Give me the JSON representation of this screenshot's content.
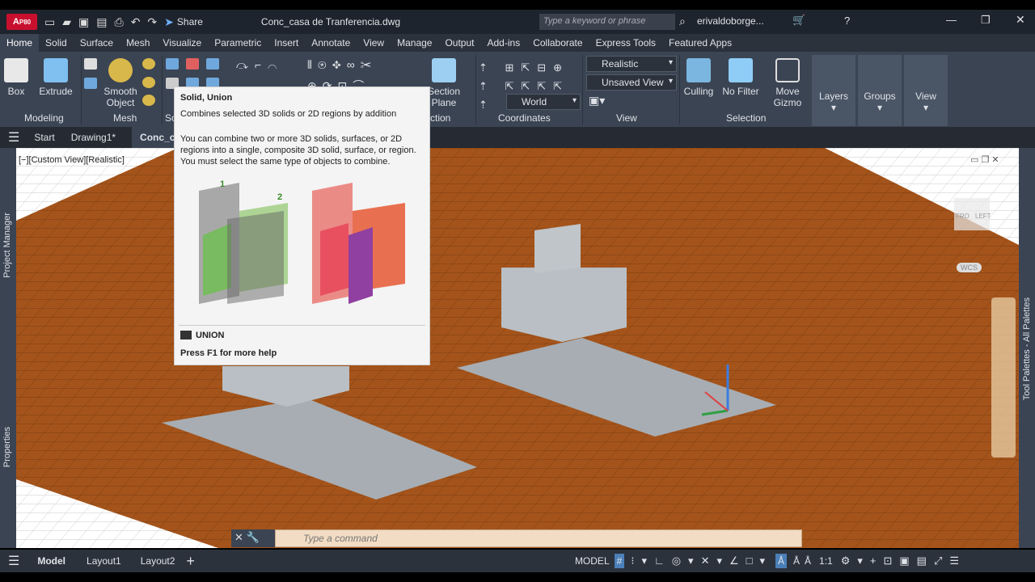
{
  "titlebar": {
    "logo": "A",
    "product": "P80",
    "share": "Share",
    "file": "Conc_casa de Tranferencia.dwg",
    "search_placeholder": "Type a keyword or phrase",
    "user": "erivaldoborge..."
  },
  "menu": [
    "Home",
    "Solid",
    "Surface",
    "Mesh",
    "Visualize",
    "Parametric",
    "Insert",
    "Annotate",
    "View",
    "Manage",
    "Output",
    "Add-ins",
    "Collaborate",
    "Express Tools",
    "Featured Apps"
  ],
  "ribbon": {
    "box": "Box",
    "extrude": "Extrude",
    "smooth1": "Smooth",
    "smooth2": "Object",
    "section1": "Section",
    "section2": "Plane",
    "panels": {
      "modeling": "Modeling",
      "mesh": "Mesh",
      "solid_edit": "So",
      "section": "ction",
      "coordinates": "Coordinates",
      "view": "View",
      "selection": "Selection"
    },
    "visual_style": "Realistic",
    "named_view": "Unsaved View",
    "ucs": "World",
    "culling": "Culling",
    "nofilter": "No Filter",
    "gizmo1": "Move",
    "gizmo2": "Gizmo",
    "layers": "Layers",
    "groups": "Groups",
    "viewbtn": "View"
  },
  "tabs": [
    "Start",
    "Drawing1*",
    "Conc_c"
  ],
  "viewport": {
    "label": "[−][Custom View][Realistic]",
    "wcs": "WCS",
    "cube_left": "LEFT",
    "cube_front": "FRO"
  },
  "tooltip": {
    "title": "Solid, Union",
    "summary": "Combines selected 3D solids or 2D regions by addition",
    "body": "You can combine two or more 3D solids, surfaces, or 2D regions into a single, composite 3D solid, surface, or region. You must select the same type of objects to combine.",
    "n1": "1",
    "n2": "2",
    "command": "UNION",
    "help": "Press F1 for more help"
  },
  "palettes": {
    "left_top": "Project Manager",
    "left_bottom": "Properties",
    "right": "Tool Palettes - All Palettes"
  },
  "command": {
    "placeholder": "Type a command"
  },
  "status": {
    "layouts": [
      "Model",
      "Layout1",
      "Layout2"
    ],
    "model": "MODEL",
    "scale": "1:1"
  },
  "colors": {
    "ground": "#a4541b",
    "accent": "#c8102e"
  }
}
